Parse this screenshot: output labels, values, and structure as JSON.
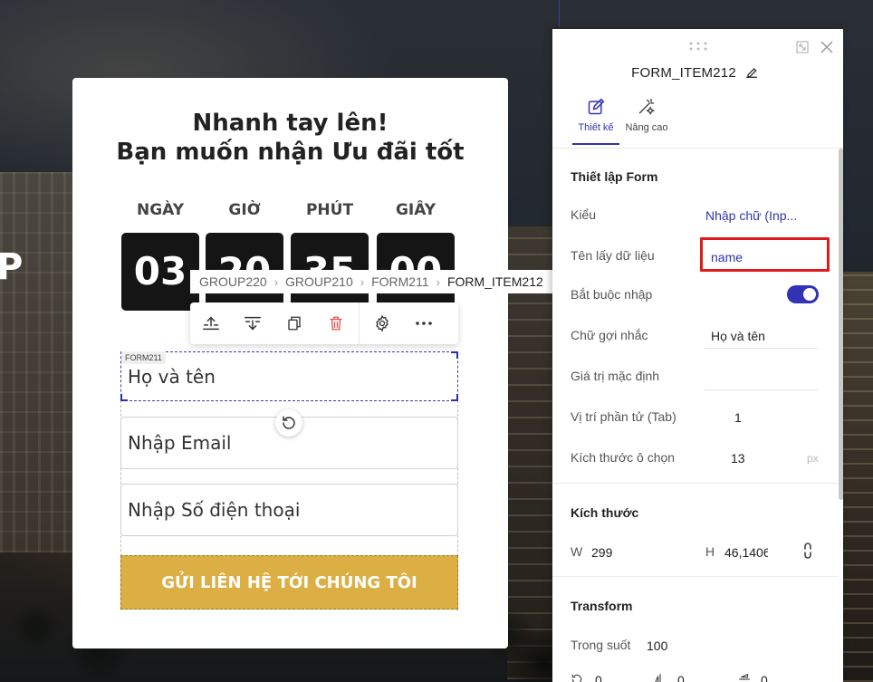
{
  "background": {
    "partial_letter": "P"
  },
  "popup": {
    "title_line1": "Nhanh tay lên!",
    "title_line2": "Bạn muốn nhận Ưu đãi tốt",
    "countdown": [
      {
        "label": "NGÀY",
        "value": "03"
      },
      {
        "label": "GIỜ",
        "value": "20"
      },
      {
        "label": "PHÚT",
        "value": "35"
      },
      {
        "label": "GIÂY",
        "value": "00"
      }
    ],
    "selected_tag": "FORM211",
    "fields": [
      {
        "text": "Họ và tên"
      },
      {
        "text": "Nhập Email"
      },
      {
        "text": "Nhập Số điện thoại"
      }
    ],
    "submit_label": "GỬI LIÊN HỆ TỚI CHÚNG TÔI",
    "accent_color": "#dcaf45"
  },
  "breadcrumb": {
    "items": [
      "GROUP220",
      "GROUP210",
      "FORM211",
      "FORM_ITEM212"
    ]
  },
  "toolbar": {
    "icons": [
      "move-up-icon",
      "move-down-icon",
      "duplicate-icon",
      "delete-icon",
      "gear-icon",
      "more-icon"
    ],
    "delete_color": "#e25555"
  },
  "panel": {
    "title": "FORM_ITEM212",
    "tabs": [
      {
        "label": "Thiết kế",
        "active": true
      },
      {
        "label": "Nâng cao",
        "active": false
      }
    ],
    "accent_color": "#3232b4",
    "form_section": {
      "title": "Thiết lập Form",
      "type_label": "Kiểu",
      "type_value": "Nhập chữ (Inp...",
      "data_name_label": "Tên lấy dữ liệu",
      "data_name_value": "name",
      "required_label": "Bắt buộc nhập",
      "required_on": true,
      "placeholder_label": "Chữ gợi nhắc",
      "placeholder_value": "Họ và tên",
      "default_label": "Giá trị mặc định",
      "default_value": "",
      "tab_label": "Vị trí phần tử (Tab)",
      "tab_value": "1",
      "size_label": "Kích thước ô chọn",
      "size_value": "13",
      "size_unit": "px"
    },
    "size_section": {
      "title": "Kích thước",
      "w_label": "W",
      "w_value": "299",
      "h_label": "H",
      "h_value": "46,1406"
    },
    "transform_section": {
      "title": "Transform",
      "opacity_label": "Trong suốt",
      "opacity_value": "100",
      "rotate_value": "0",
      "flip_x_value": "0",
      "flip_y_value": "0"
    }
  }
}
